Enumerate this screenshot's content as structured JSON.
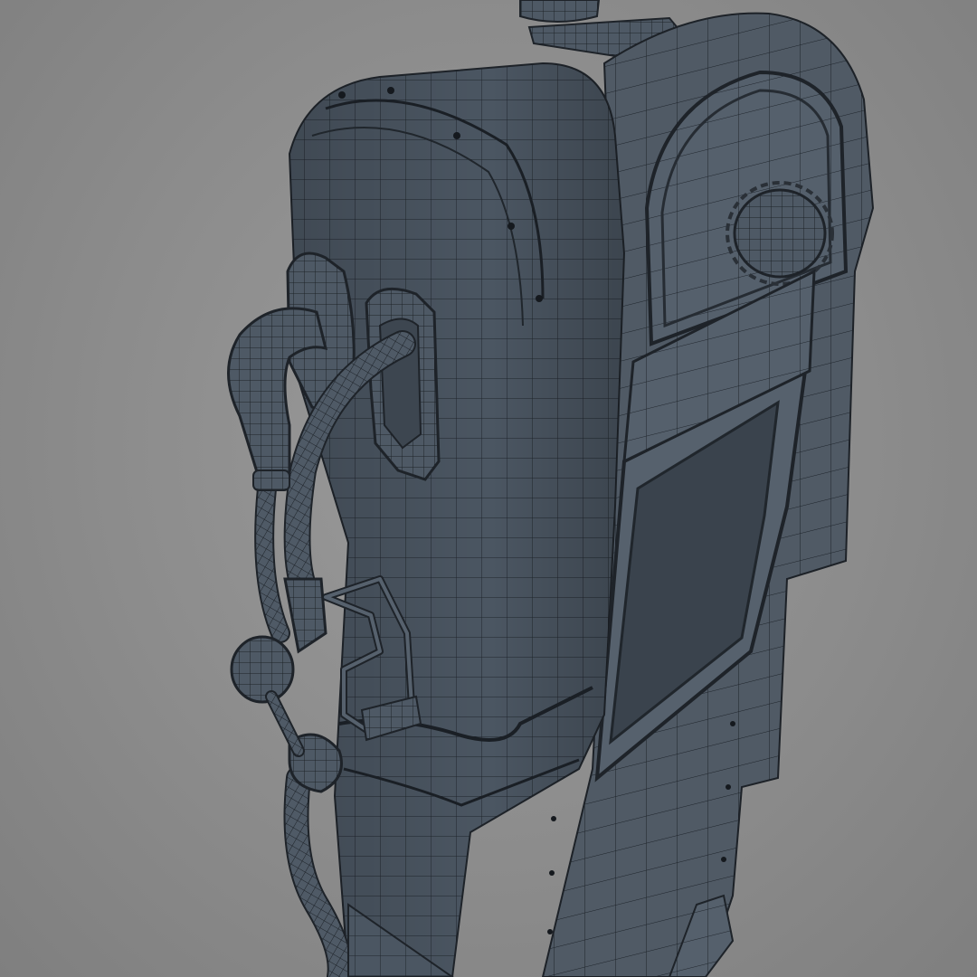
{
  "scene": {
    "subject": "wireframe-gas-pump",
    "background_color": "#8c8c8c",
    "mesh_fill_color": "#4a5561",
    "mesh_shade_color": "#3b444e",
    "wire_color": "#1e2329",
    "display_glass_color": "#3a434d"
  }
}
